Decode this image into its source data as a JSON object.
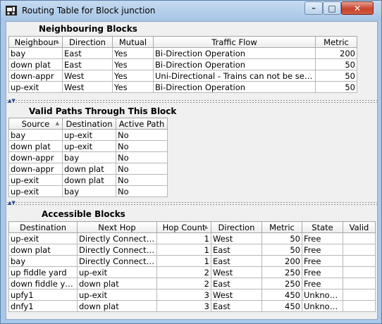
{
  "window": {
    "title": "Routing Table for Block junction",
    "controls": {
      "minimize": "–",
      "maximize": "□",
      "close": "✕"
    }
  },
  "neighbours": {
    "title": "Neighbouring Blocks",
    "columns": [
      "Neighbour",
      "Direction",
      "Mutual",
      "Traffic Flow",
      "Metric"
    ],
    "sort_indicator": "▲",
    "rows": [
      [
        "bay",
        "East",
        "Yes",
        "Bi-Direction Operation",
        "200"
      ],
      [
        "down plat",
        "East",
        "Yes",
        "Bi-Direction Operation",
        "50"
      ],
      [
        "down-appr",
        "West",
        "Yes",
        "Uni-Directional - Trains can not be sent ...",
        "50"
      ],
      [
        "up-exit",
        "West",
        "Yes",
        "Bi-Direction Operation",
        "50"
      ]
    ]
  },
  "paths": {
    "title": "Valid Paths Through This Block",
    "columns": [
      "Source",
      "Destination",
      "Active Path"
    ],
    "sort_indicator": "▲",
    "rows": [
      [
        "bay",
        "up-exit",
        "No"
      ],
      [
        "down plat",
        "up-exit",
        "No"
      ],
      [
        "down-appr",
        "bay",
        "No"
      ],
      [
        "down-appr",
        "down plat",
        "No"
      ],
      [
        "up-exit",
        "down plat",
        "No"
      ],
      [
        "up-exit",
        "bay",
        "No"
      ]
    ]
  },
  "accessible": {
    "title": "Accessible Blocks",
    "columns": [
      "Destination",
      "Next Hop",
      "Hop Count",
      "Direction",
      "Metric",
      "State",
      "Valid"
    ],
    "sort_indicator": "▲",
    "rows": [
      [
        "up-exit",
        "Directly Connected",
        "1",
        "West",
        "50",
        "Free",
        ""
      ],
      [
        "down plat",
        "Directly Connected",
        "1",
        "East",
        "50",
        "Free",
        ""
      ],
      [
        "bay",
        "Directly Connected",
        "1",
        "East",
        "200",
        "Free",
        ""
      ],
      [
        "up fiddle yard",
        "up-exit",
        "2",
        "West",
        "250",
        "Free",
        ""
      ],
      [
        "down fiddle yard",
        "down plat",
        "2",
        "East",
        "250",
        "Free",
        ""
      ],
      [
        "upfy1",
        "up-exit",
        "3",
        "West",
        "450",
        "Unknown",
        ""
      ],
      [
        "dnfy1",
        "down plat",
        "3",
        "East",
        "450",
        "Unknown",
        ""
      ]
    ]
  },
  "divider_arrows": "▲▼",
  "colors": {
    "header_bg": "#ececec",
    "grid_line": "#b8b8b8",
    "title_bar": "#b5d0ec"
  }
}
